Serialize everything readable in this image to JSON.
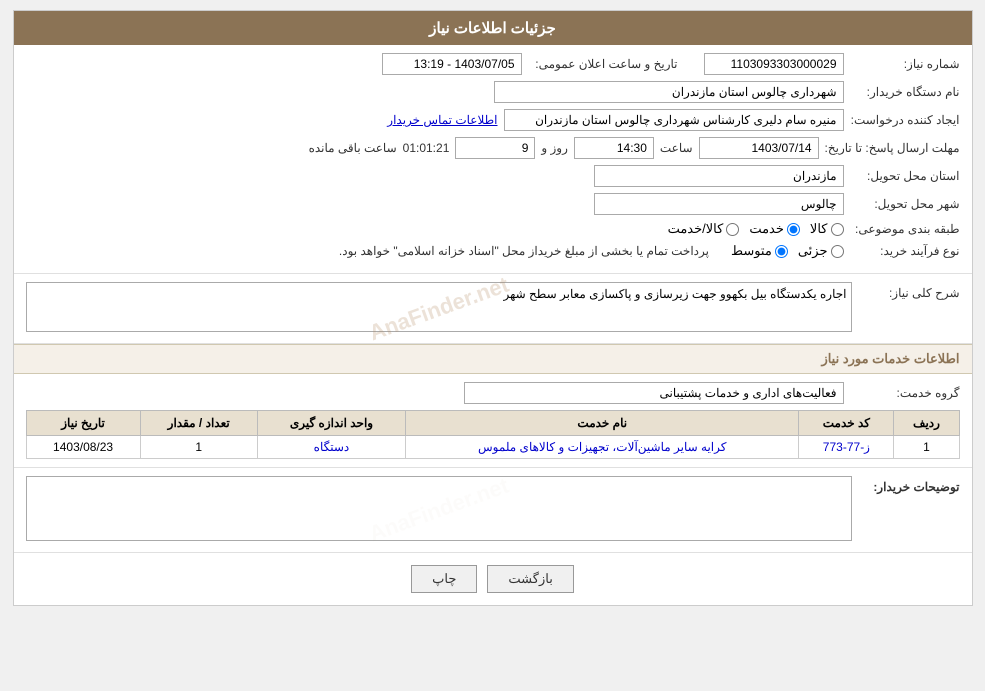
{
  "header": {
    "title": "جزئیات اطلاعات نیاز"
  },
  "info": {
    "need_number_label": "شماره نیاز:",
    "need_number_value": "1103093303000029",
    "buyer_org_label": "نام دستگاه خریدار:",
    "buyer_org_value": "شهرداری چالوس استان مازندران",
    "requester_label": "ایجاد کننده درخواست:",
    "requester_value": "منیره سام دلیری کارشناس شهرداری چالوس استان مازندران",
    "contact_link": "اطلاعات تماس خریدار",
    "announce_datetime_label": "تاریخ و ساعت اعلان عمومی:",
    "announce_datetime_value": "1403/07/05 - 13:19",
    "response_deadline_label": "مهلت ارسال پاسخ: تا تاریخ:",
    "response_date_value": "1403/07/14",
    "response_time_label": "ساعت",
    "response_time_value": "14:30",
    "remaining_days_label": "روز و",
    "remaining_days_value": "9",
    "remaining_time_value": "01:01:21",
    "remaining_suffix": "ساعت باقی مانده",
    "province_label": "استان محل تحویل:",
    "province_value": "مازندران",
    "city_label": "شهر محل تحویل:",
    "city_value": "چالوس",
    "category_label": "طبقه بندی موضوعی:",
    "category_kala": "کالا",
    "category_khadamat": "خدمت",
    "category_kala_khadamat": "کالا/خدمت",
    "purchase_type_label": "نوع فرآیند خرید:",
    "purchase_type_jozii": "جزئی",
    "purchase_type_motavasset": "متوسط",
    "purchase_note": "پرداخت تمام یا بخشی از مبلغ خریداز محل \"اسناد خزانه اسلامی\" خواهد بود.",
    "need_description_label": "شرح کلی نیاز:",
    "need_description_value": "اجاره یکدستگاه بیل بکهوو جهت زیرسازی و پاکسازی معابر سطح شهر"
  },
  "services_section": {
    "title": "اطلاعات خدمات مورد نیاز",
    "service_group_label": "گروه خدمت:",
    "service_group_value": "فعالیت‌های اداری و خدمات پشتیبانی",
    "table": {
      "headers": [
        "ردیف",
        "کد خدمت",
        "نام خدمت",
        "واحد اندازه گیری",
        "تعداد / مقدار",
        "تاریخ نیاز"
      ],
      "rows": [
        {
          "row_num": "1",
          "service_code": "ز-77-773",
          "service_name": "کرایه سایر ماشین‌آلات، تجهیزات و کالاهای ملموس",
          "unit": "دستگاه",
          "quantity": "1",
          "date": "1403/08/23"
        }
      ]
    }
  },
  "buyer_notes": {
    "label": "توضیحات خریدار:",
    "value": ""
  },
  "buttons": {
    "back_label": "بازگشت",
    "print_label": "چاپ"
  }
}
